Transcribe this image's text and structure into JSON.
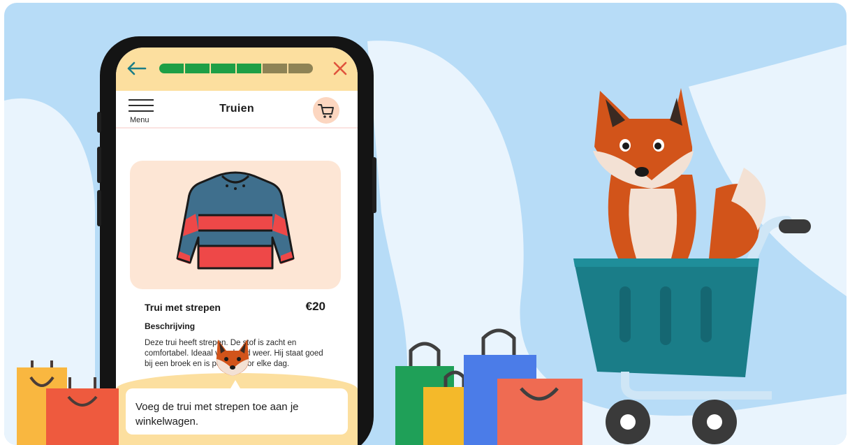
{
  "top_bar": {
    "progress_completed": 4,
    "progress_total": 6,
    "back_icon": "arrow-left-icon",
    "close_icon": "close-icon"
  },
  "nav": {
    "menu_label": "Menu",
    "title": "Truien",
    "cart_icon": "shopping-cart-icon"
  },
  "product": {
    "name": "Trui met strepen",
    "price": "€20",
    "description_heading": "Beschrijving",
    "description": "Deze trui heeft strepen. De stof is zacht en comfortabel. Ideaal voor koud weer. Hij staat goed bij een broek en is perfect voor elke dag."
  },
  "dialog": {
    "message": "Voeg de trui met strepen toe aan je winkelwagen."
  },
  "colors": {
    "accent_yellow": "#fcdf9f",
    "progress_done": "#1e9f46",
    "progress_todo": "#8e8355",
    "back_arrow": "#1b7d87",
    "close_x": "#e0533c",
    "background": "#b7dcf7"
  }
}
